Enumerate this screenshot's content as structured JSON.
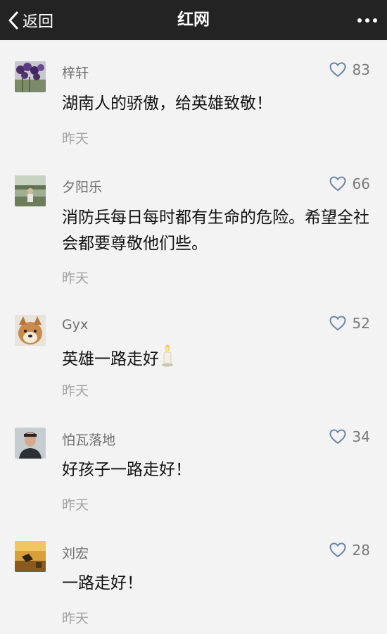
{
  "nav": {
    "back_label": "返回",
    "title": "红网"
  },
  "comments": [
    {
      "username": "梓轩",
      "likes": "83",
      "text": "湖南人的骄傲，给英雄致敬！",
      "time": "昨天",
      "avatar_icon": "purple-flowers-avatar"
    },
    {
      "username": "夕阳乐",
      "likes": "66",
      "text": "消防兵每日每时都有生命的危险。希望全社会都要尊敬他们些。",
      "time": "昨天",
      "avatar_icon": "outdoor-person-avatar"
    },
    {
      "username": "Gyx",
      "likes": "52",
      "text": "英雄一路走好",
      "time": "昨天",
      "avatar_icon": "shiba-dog-avatar",
      "emoji_icon": "candle-icon"
    },
    {
      "username": "怕瓦落地",
      "likes": "34",
      "text": "好孩子一路走好！",
      "time": "昨天",
      "avatar_icon": "man-portrait-avatar"
    },
    {
      "username": "刘宏",
      "likes": "28",
      "text": "一路走好！",
      "time": "昨天",
      "avatar_icon": "sunset-scene-avatar"
    }
  ]
}
